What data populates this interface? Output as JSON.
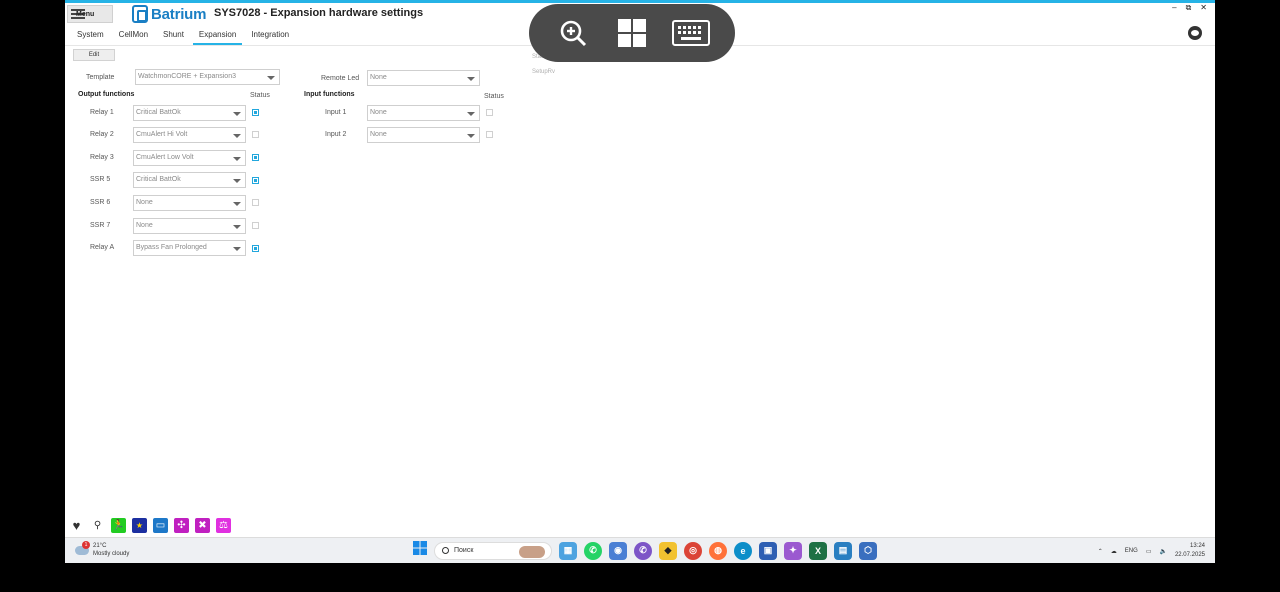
{
  "window": {
    "menu_label": "Menu",
    "brand": "Batrium",
    "title": "SYS7028 - Expansion hardware settings",
    "controls": [
      "–",
      "⧉",
      "✕"
    ]
  },
  "tabs": [
    {
      "label": "System",
      "active": false
    },
    {
      "label": "CellMon",
      "active": false
    },
    {
      "label": "Shunt",
      "active": false
    },
    {
      "label": "Expansion",
      "active": true
    },
    {
      "label": "Integration",
      "active": false
    }
  ],
  "edit_label": "Edit",
  "template": {
    "label": "Template",
    "value": "WatchmonCORE + Expansion3"
  },
  "remote_led": {
    "label": "Remote Led",
    "value": "None"
  },
  "ghost_labels": [
    "Status",
    "SetupRv"
  ],
  "outputs": {
    "header": "Output functions",
    "status_header": "Status",
    "rows": [
      {
        "label": "Relay 1",
        "value": "Critical BattOk",
        "status": true
      },
      {
        "label": "Relay 2",
        "value": "CmuAlert Hi Volt",
        "status": false
      },
      {
        "label": "Relay 3",
        "value": "CmuAlert Low Volt",
        "status": true
      },
      {
        "label": "SSR 5",
        "value": "Critical BattOk",
        "status": true
      },
      {
        "label": "SSR 6",
        "value": "None",
        "status": false
      },
      {
        "label": "SSR 7",
        "value": "None",
        "status": false
      },
      {
        "label": "Relay A",
        "value": "Bypass Fan Prolonged",
        "status": true
      }
    ]
  },
  "inputs": {
    "header": "Input functions",
    "status_header": "Status",
    "rows": [
      {
        "label": "Input 1",
        "value": "None",
        "status": false
      },
      {
        "label": "Input 2",
        "value": "None",
        "status": false
      }
    ]
  },
  "overlay_icons": [
    "zoom-in-icon",
    "windows-snap-icon",
    "keyboard-icon"
  ],
  "status_icons": [
    {
      "name": "heart-icon",
      "color": "#333333",
      "glyph": "♥"
    },
    {
      "name": "connection-icon",
      "color": "#333333",
      "glyph": "⚲"
    },
    {
      "name": "running-man-icon",
      "color": "#22cc22",
      "glyph": "🏃"
    },
    {
      "name": "eu-flag-icon",
      "color": "#1c2fa0",
      "glyph": "★"
    },
    {
      "name": "battery-icon",
      "color": "#1e78c8",
      "glyph": "▭"
    },
    {
      "name": "fan-icon",
      "color": "#c020c0",
      "glyph": "✣"
    },
    {
      "name": "tools-icon",
      "color": "#c020c0",
      "glyph": "✖"
    },
    {
      "name": "balance-icon",
      "color": "#e030e0",
      "glyph": "⚖"
    }
  ],
  "taskbar": {
    "weather_temp": "21°C",
    "weather_text": "Mostly cloudy",
    "weather_badge": "1",
    "search_placeholder": "Поиск",
    "language": "ENG",
    "time": "13:24",
    "date": "22.07.2025",
    "apps": [
      {
        "name": "widgets-app-icon",
        "color": "#4da3e0",
        "glyph": "▦"
      },
      {
        "name": "whatsapp-app-icon",
        "color": "#25d366",
        "glyph": "✆"
      },
      {
        "name": "app-icon",
        "color": "#4a7fd4",
        "glyph": "◉"
      },
      {
        "name": "viber-app-icon",
        "color": "#7d55c7",
        "glyph": "✆"
      },
      {
        "name": "batman-app-icon",
        "color": "#222222",
        "glyph": "◆"
      },
      {
        "name": "chrome-app-icon",
        "color": "#db4437",
        "glyph": "◎"
      },
      {
        "name": "firefox-app-icon",
        "color": "#ff7139",
        "glyph": "◍"
      },
      {
        "name": "edge-app-icon",
        "color": "#0c8ec9",
        "glyph": "e"
      },
      {
        "name": "save-app-icon",
        "color": "#2e5fb3",
        "glyph": "▣"
      },
      {
        "name": "copilot-app-icon",
        "color": "#9b59d0",
        "glyph": "✦"
      },
      {
        "name": "excel-app-icon",
        "color": "#1e7145",
        "glyph": "X"
      },
      {
        "name": "device-app-icon",
        "color": "#2a7fc1",
        "glyph": "▤"
      },
      {
        "name": "cube-app-icon",
        "color": "#3a6fbf",
        "glyph": "⬡"
      }
    ]
  }
}
